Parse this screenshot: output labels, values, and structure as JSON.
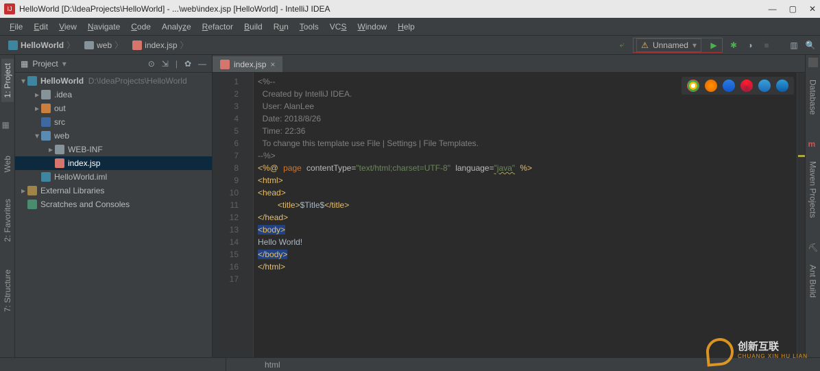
{
  "titlebar": {
    "text": "HelloWorld [D:\\IdeaProjects\\HelloWorld] - ...\\web\\index.jsp [HelloWorld] - IntelliJ IDEA"
  },
  "menu": [
    "File",
    "Edit",
    "View",
    "Navigate",
    "Code",
    "Analyze",
    "Refactor",
    "Build",
    "Run",
    "Tools",
    "VCS",
    "Window",
    "Help"
  ],
  "breadcrumbs": {
    "a": "HelloWorld",
    "b": "web",
    "c": "index.jsp"
  },
  "run_config": {
    "label": "Unnamed"
  },
  "project_panel": {
    "title": "Project"
  },
  "tree": {
    "root": "HelloWorld",
    "root_path": "D:\\IdeaProjects\\HelloWorld",
    "idea": ".idea",
    "out": "out",
    "src": "src",
    "web": "web",
    "webinf": "WEB-INF",
    "indexjsp": "index.jsp",
    "iml": "HelloWorld.iml",
    "ext": "External Libraries",
    "scratch": "Scratches and Consoles"
  },
  "tabs": {
    "t1": "index.jsp"
  },
  "code": {
    "l1": "<%--",
    "l2": "  Created by IntelliJ IDEA.",
    "l3": "  User: AlanLee",
    "l4": "  Date: 2018/8/26",
    "l5": "  Time: 22:36",
    "l6": "  To change this template use File | Settings | File Templates.",
    "l7": "--%>",
    "l8_directive": "<%@",
    "l8_page": "page",
    "l8_ct_attr": "contentType=",
    "l8_ct_val": "\"text/html;charset=UTF-8\"",
    "l8_lang_attr": "language=",
    "l8_lang_val": "\"java\"",
    "l8_end": "%>",
    "l9": "<html>",
    "l10": "<head>",
    "l11_open": "<title>",
    "l11_text": "$Title$",
    "l11_close": "</title>",
    "l12": "</head>",
    "l13": "<body>",
    "l14": "Hello World!",
    "l15": "</body>",
    "l16": "</html>"
  },
  "line_numbers": [
    "1",
    "2",
    "3",
    "4",
    "5",
    "6",
    "7",
    "8",
    "9",
    "10",
    "11",
    "12",
    "13",
    "14",
    "15",
    "16",
    "17"
  ],
  "left_tabs": {
    "project": "1: Project",
    "web": "Web",
    "favorites": "2: Favorites",
    "structure": "7: Structure"
  },
  "right_tabs": {
    "database": "Database",
    "maven": "Maven Projects",
    "ant": "Ant Build"
  },
  "status": {
    "crumb": "html"
  },
  "watermark": {
    "cn": "创新互联",
    "en": "CHUANG XIN HU LIAN"
  }
}
